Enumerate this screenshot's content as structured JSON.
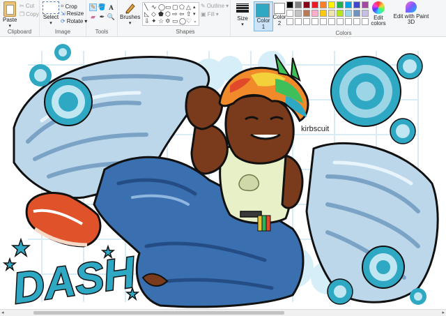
{
  "ribbon": {
    "clipboard": {
      "paste": "Paste",
      "cut": "Cut",
      "copy": "Copy",
      "label": "Clipboard"
    },
    "image": {
      "select": "Select",
      "crop": "Crop",
      "resize": "Resize",
      "rotate": "Rotate",
      "label": "Image"
    },
    "tools": {
      "label": "Tools",
      "brushes": "Brushes"
    },
    "shapes": {
      "outline": "Outline",
      "fill": "Fill",
      "label": "Shapes"
    },
    "size": {
      "label": "Size"
    },
    "colors": {
      "color1": "Color 1",
      "color2": "Color 2",
      "color1_hex": "#2fa8c4",
      "color2_hex": "#ffffff",
      "edit_colors": "Edit colors",
      "edit_paint3d": "Edit with Paint 3D",
      "label": "Colors",
      "palette": [
        "#000000",
        "#7f7f7f",
        "#880015",
        "#ed1c24",
        "#ff7f27",
        "#fff200",
        "#22b14c",
        "#00a2e8",
        "#3f48cc",
        "#a349a4",
        "#ffffff",
        "#c3c3c3",
        "#b97a57",
        "#ffaec9",
        "#ffc90e",
        "#efe4b0",
        "#b5e61d",
        "#99d9ea",
        "#7092be",
        "#c8bfe7",
        "#ffffff",
        "#ffffff",
        "#ffffff",
        "#ffffff",
        "#ffffff",
        "#ffffff",
        "#ffffff",
        "#ffffff",
        "#ffffff",
        "#ffffff"
      ]
    }
  },
  "canvas": {
    "signature": "kirbscuit",
    "title_text": "DASH"
  }
}
